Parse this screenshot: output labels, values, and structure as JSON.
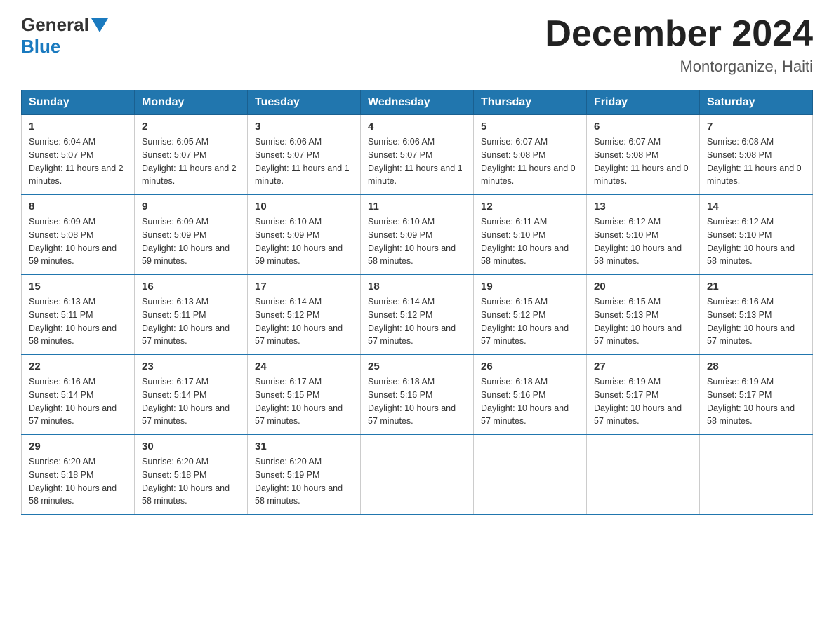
{
  "header": {
    "logo_general": "General",
    "logo_blue": "Blue",
    "month_title": "December 2024",
    "location": "Montorganize, Haiti"
  },
  "days_of_week": [
    "Sunday",
    "Monday",
    "Tuesday",
    "Wednesday",
    "Thursday",
    "Friday",
    "Saturday"
  ],
  "weeks": [
    [
      {
        "day": "1",
        "sunrise": "6:04 AM",
        "sunset": "5:07 PM",
        "daylight": "11 hours and 2 minutes."
      },
      {
        "day": "2",
        "sunrise": "6:05 AM",
        "sunset": "5:07 PM",
        "daylight": "11 hours and 2 minutes."
      },
      {
        "day": "3",
        "sunrise": "6:06 AM",
        "sunset": "5:07 PM",
        "daylight": "11 hours and 1 minute."
      },
      {
        "day": "4",
        "sunrise": "6:06 AM",
        "sunset": "5:07 PM",
        "daylight": "11 hours and 1 minute."
      },
      {
        "day": "5",
        "sunrise": "6:07 AM",
        "sunset": "5:08 PM",
        "daylight": "11 hours and 0 minutes."
      },
      {
        "day": "6",
        "sunrise": "6:07 AM",
        "sunset": "5:08 PM",
        "daylight": "11 hours and 0 minutes."
      },
      {
        "day": "7",
        "sunrise": "6:08 AM",
        "sunset": "5:08 PM",
        "daylight": "11 hours and 0 minutes."
      }
    ],
    [
      {
        "day": "8",
        "sunrise": "6:09 AM",
        "sunset": "5:08 PM",
        "daylight": "10 hours and 59 minutes."
      },
      {
        "day": "9",
        "sunrise": "6:09 AM",
        "sunset": "5:09 PM",
        "daylight": "10 hours and 59 minutes."
      },
      {
        "day": "10",
        "sunrise": "6:10 AM",
        "sunset": "5:09 PM",
        "daylight": "10 hours and 59 minutes."
      },
      {
        "day": "11",
        "sunrise": "6:10 AM",
        "sunset": "5:09 PM",
        "daylight": "10 hours and 58 minutes."
      },
      {
        "day": "12",
        "sunrise": "6:11 AM",
        "sunset": "5:10 PM",
        "daylight": "10 hours and 58 minutes."
      },
      {
        "day": "13",
        "sunrise": "6:12 AM",
        "sunset": "5:10 PM",
        "daylight": "10 hours and 58 minutes."
      },
      {
        "day": "14",
        "sunrise": "6:12 AM",
        "sunset": "5:10 PM",
        "daylight": "10 hours and 58 minutes."
      }
    ],
    [
      {
        "day": "15",
        "sunrise": "6:13 AM",
        "sunset": "5:11 PM",
        "daylight": "10 hours and 58 minutes."
      },
      {
        "day": "16",
        "sunrise": "6:13 AM",
        "sunset": "5:11 PM",
        "daylight": "10 hours and 57 minutes."
      },
      {
        "day": "17",
        "sunrise": "6:14 AM",
        "sunset": "5:12 PM",
        "daylight": "10 hours and 57 minutes."
      },
      {
        "day": "18",
        "sunrise": "6:14 AM",
        "sunset": "5:12 PM",
        "daylight": "10 hours and 57 minutes."
      },
      {
        "day": "19",
        "sunrise": "6:15 AM",
        "sunset": "5:12 PM",
        "daylight": "10 hours and 57 minutes."
      },
      {
        "day": "20",
        "sunrise": "6:15 AM",
        "sunset": "5:13 PM",
        "daylight": "10 hours and 57 minutes."
      },
      {
        "day": "21",
        "sunrise": "6:16 AM",
        "sunset": "5:13 PM",
        "daylight": "10 hours and 57 minutes."
      }
    ],
    [
      {
        "day": "22",
        "sunrise": "6:16 AM",
        "sunset": "5:14 PM",
        "daylight": "10 hours and 57 minutes."
      },
      {
        "day": "23",
        "sunrise": "6:17 AM",
        "sunset": "5:14 PM",
        "daylight": "10 hours and 57 minutes."
      },
      {
        "day": "24",
        "sunrise": "6:17 AM",
        "sunset": "5:15 PM",
        "daylight": "10 hours and 57 minutes."
      },
      {
        "day": "25",
        "sunrise": "6:18 AM",
        "sunset": "5:16 PM",
        "daylight": "10 hours and 57 minutes."
      },
      {
        "day": "26",
        "sunrise": "6:18 AM",
        "sunset": "5:16 PM",
        "daylight": "10 hours and 57 minutes."
      },
      {
        "day": "27",
        "sunrise": "6:19 AM",
        "sunset": "5:17 PM",
        "daylight": "10 hours and 57 minutes."
      },
      {
        "day": "28",
        "sunrise": "6:19 AM",
        "sunset": "5:17 PM",
        "daylight": "10 hours and 58 minutes."
      }
    ],
    [
      {
        "day": "29",
        "sunrise": "6:20 AM",
        "sunset": "5:18 PM",
        "daylight": "10 hours and 58 minutes."
      },
      {
        "day": "30",
        "sunrise": "6:20 AM",
        "sunset": "5:18 PM",
        "daylight": "10 hours and 58 minutes."
      },
      {
        "day": "31",
        "sunrise": "6:20 AM",
        "sunset": "5:19 PM",
        "daylight": "10 hours and 58 minutes."
      },
      {
        "day": "",
        "sunrise": "",
        "sunset": "",
        "daylight": ""
      },
      {
        "day": "",
        "sunrise": "",
        "sunset": "",
        "daylight": ""
      },
      {
        "day": "",
        "sunrise": "",
        "sunset": "",
        "daylight": ""
      },
      {
        "day": "",
        "sunrise": "",
        "sunset": "",
        "daylight": ""
      }
    ]
  ]
}
